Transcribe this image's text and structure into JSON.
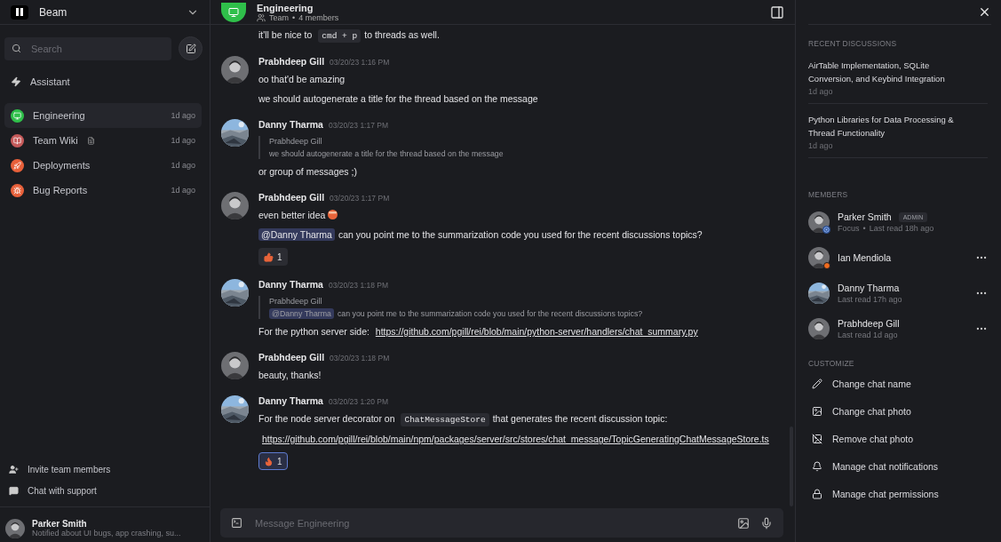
{
  "workspace": {
    "name": "Beam"
  },
  "search": {
    "placeholder": "Search"
  },
  "assistant": {
    "label": "Assistant"
  },
  "channels": [
    {
      "name": "Engineering",
      "time": "1d ago",
      "color": "#2fbf4a",
      "selected": true,
      "doc": false
    },
    {
      "name": "Team Wiki",
      "time": "1d ago",
      "color": "#c55a5a",
      "selected": false,
      "doc": true
    },
    {
      "name": "Deployments",
      "time": "1d ago",
      "color": "#e8603a",
      "selected": false,
      "doc": false
    },
    {
      "name": "Bug Reports",
      "time": "1d ago",
      "color": "#e8603a",
      "selected": false,
      "doc": false
    }
  ],
  "sidebar_actions": [
    {
      "label": "Invite team members"
    },
    {
      "label": "Chat with support"
    }
  ],
  "current_user": {
    "name": "Parker Smith",
    "status": "Notified about UI bugs, app crashing, su..."
  },
  "chat_header": {
    "title": "Engineering",
    "kind_label": "Team",
    "separator": "•",
    "members": "4 members"
  },
  "messages": [
    {
      "paragraphs": [
        [
          {
            "kind": "text",
            "text": "it'll be nice to"
          },
          {
            "kind": "code",
            "text": "cmd + p"
          },
          {
            "kind": "text",
            "text": "to threads as well."
          }
        ]
      ]
    },
    {
      "author": "Prabhdeep Gill",
      "time": "03/20/23 1:16 PM",
      "paragraphs": [
        [
          {
            "kind": "text",
            "text": "oo that'd be amazing"
          }
        ],
        [
          {
            "kind": "text",
            "text": "we should autogenerate a title for the thread based on the message"
          }
        ]
      ]
    },
    {
      "author": "Danny Tharma",
      "time": "03/20/23 1:17 PM",
      "quote": {
        "author": "Prabhdeep Gill",
        "segments": [
          {
            "kind": "text",
            "text": "we should autogenerate a title for the thread based on the message"
          }
        ]
      },
      "paragraphs": [
        [
          {
            "kind": "text",
            "text": "or group of messages ;)"
          }
        ]
      ]
    },
    {
      "author": "Prabhdeep Gill",
      "time": "03/20/23 1:17 PM",
      "paragraphs": [
        [
          {
            "kind": "text",
            "text": "even better idea"
          },
          {
            "kind": "emoji"
          }
        ],
        [
          {
            "kind": "mention",
            "text": "@Danny Tharma"
          },
          {
            "kind": "text",
            "text": "can you point me to the summarization code you used for the recent discussions topics?"
          }
        ]
      ],
      "reactions": [
        {
          "count": "1",
          "selected": false
        }
      ]
    },
    {
      "author": "Danny Tharma",
      "time": "03/20/23 1:18 PM",
      "quote": {
        "author": "Prabhdeep Gill",
        "segments": [
          {
            "kind": "mention",
            "text": "@Danny Tharma"
          },
          {
            "kind": "text",
            "text": "can you point me to the summarization code you used for the recent discussions topics?"
          }
        ]
      },
      "paragraphs": [
        [
          {
            "kind": "text",
            "text": "For the python server side:"
          },
          {
            "kind": "link",
            "text": "https://github.com/pgill/rei/blob/main/python-server/handlers/chat_summary.py"
          }
        ]
      ]
    },
    {
      "author": "Prabhdeep Gill",
      "time": "03/20/23 1:18 PM",
      "paragraphs": [
        [
          {
            "kind": "text",
            "text": "beauty, thanks!"
          }
        ]
      ]
    },
    {
      "author": "Danny Tharma",
      "time": "03/20/23 1:20 PM",
      "paragraphs": [
        [
          {
            "kind": "text",
            "text": "For the node server decorator on"
          },
          {
            "kind": "code",
            "text": "ChatMessageStore"
          },
          {
            "kind": "text",
            "text": "that generates the recent discussion topic:"
          }
        ],
        [
          {
            "kind": "link",
            "text": "https://github.com/pgill/rei/blob/main/npm/packages/server/src/stores/chat_message/TopicGeneratingChatMessageStore.ts"
          }
        ]
      ],
      "reactions": [
        {
          "count": "1",
          "selected": true
        }
      ]
    }
  ],
  "composer": {
    "placeholder": "Message Engineering"
  },
  "recent_discussions": {
    "heading": "RECENT DISCUSSIONS",
    "items": [
      {
        "title": "AirTable Implementation, SQLite Conversion, and Keybind Integration",
        "time": "1d ago"
      },
      {
        "title": "Python Libraries for Data Processing & Thread Functionality",
        "time": "1d ago"
      }
    ]
  },
  "members": {
    "heading": "MEMBERS",
    "items": [
      {
        "name": "Parker Smith",
        "badge": "ADMIN",
        "detail": "Focus",
        "separator": "•",
        "last_read": "Last read 18h ago",
        "menu": false
      },
      {
        "name": "Ian Mendiola",
        "color": "#f06b1e",
        "menu": true
      },
      {
        "name": "Danny Tharma",
        "last_read": "Last read 17h ago",
        "menu": true
      },
      {
        "name": "Prabhdeep Gill",
        "last_read": "Last read 1d ago",
        "menu": true
      }
    ]
  },
  "customize": {
    "heading": "CUSTOMIZE",
    "items": [
      {
        "label": "Change chat name"
      },
      {
        "label": "Change chat photo"
      },
      {
        "label": "Remove chat photo"
      },
      {
        "label": "Manage chat notifications"
      },
      {
        "label": "Manage chat permissions"
      }
    ]
  }
}
